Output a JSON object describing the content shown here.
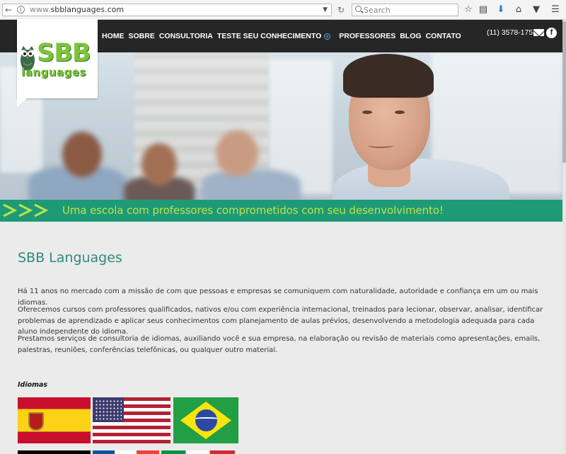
{
  "browser": {
    "url_prefix": "www.",
    "url_domain": "sbblanguages.com",
    "search_placeholder": "Search"
  },
  "header": {
    "logo_top": "SBB",
    "logo_bottom": "languages",
    "nav": [
      "HOME",
      "SOBRE",
      "CONSULTORIA",
      "TESTE SEU CONHECIMENTO",
      "PROFESSORES",
      "BLOG",
      "CONTATO"
    ],
    "phone": "(11) 3578-1757",
    "facebook_letter": "f"
  },
  "banner": {
    "text": "Uma escola com professores comprometidos com seu desenvolvimento!"
  },
  "content": {
    "title": "SBB Languages",
    "p1": "Há 11 anos no mercado com a missão de com que pessoas e empresas se comuniquem com naturalidade, autoridade e confiança em um ou mais idiomas.",
    "p2": "Oferecemos cursos com professores qualificados, nativos e/ou com experiência internacional, treinados para lecionar, observar, analisar, identificar problemas de aprendizado e aplicar seus conhecimentos com planejamento de aulas prévios, desenvolvendo a metodologia adequada para cada aluno independente do idioma.",
    "p3": "Prestamos serviços de consultoria de idiomas, auxiliando você e sua empresa, na elaboração ou revisão de materiais como apresentações, emails, palestras, reuniões, conferências telefônicas, ou qualquer outro material.",
    "languages_heading": "Idiomas"
  },
  "colors": {
    "brand_green": "#7dc43a",
    "banner_teal": "#1f9a76",
    "title_teal": "#2f8b7d",
    "header_dark": "#262626"
  },
  "icons": [
    "back-arrow-icon",
    "info-icon",
    "dropdown-icon",
    "reload-icon",
    "search-icon",
    "star-icon",
    "reader-icon",
    "download-icon",
    "home-icon",
    "pocket-icon",
    "menu-icon",
    "expand-plus-icon",
    "mail-icon",
    "facebook-icon",
    "owl-icon",
    "triple-arrow-icon"
  ]
}
